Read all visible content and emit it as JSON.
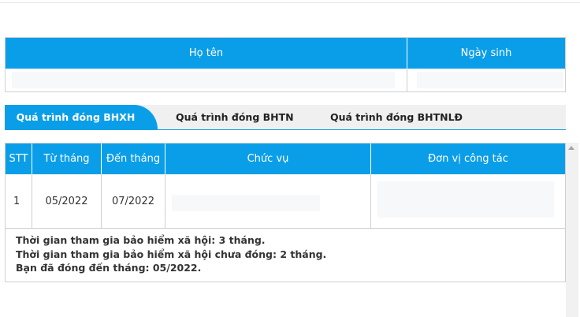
{
  "person_table": {
    "headers": {
      "name": "Họ tên",
      "dob": "Ngày sinh"
    },
    "row": {
      "name": "",
      "dob": ""
    }
  },
  "tabs": [
    {
      "label": "Quá trình đóng BHXH",
      "active": true
    },
    {
      "label": "Quá trình đóng BHTN",
      "active": false
    },
    {
      "label": "Quá trình đóng BHTNLĐ",
      "active": false
    }
  ],
  "history_table": {
    "headers": [
      "STT",
      "Từ tháng",
      "Đến tháng",
      "Chức vụ",
      "Đơn vị công tác"
    ],
    "rows": [
      {
        "stt": "1",
        "from": "05/2022",
        "to": "07/2022",
        "position": "",
        "unit": ""
      }
    ]
  },
  "summary": {
    "line1": "Thời gian tham gia bảo hiểm xã hội: 3 tháng.",
    "line2": "Thời gian tham gia bảo hiểm xã hội chưa đóng: 2 tháng.",
    "line3": "Bạn đã đóng đến tháng: 05/2022."
  },
  "colors": {
    "accent": "#0b9ee8",
    "border": "#cfcfcf",
    "tab_bar": "#f0f0f0"
  },
  "icons": {
    "scroll_up": "scroll-up-arrow-icon"
  }
}
